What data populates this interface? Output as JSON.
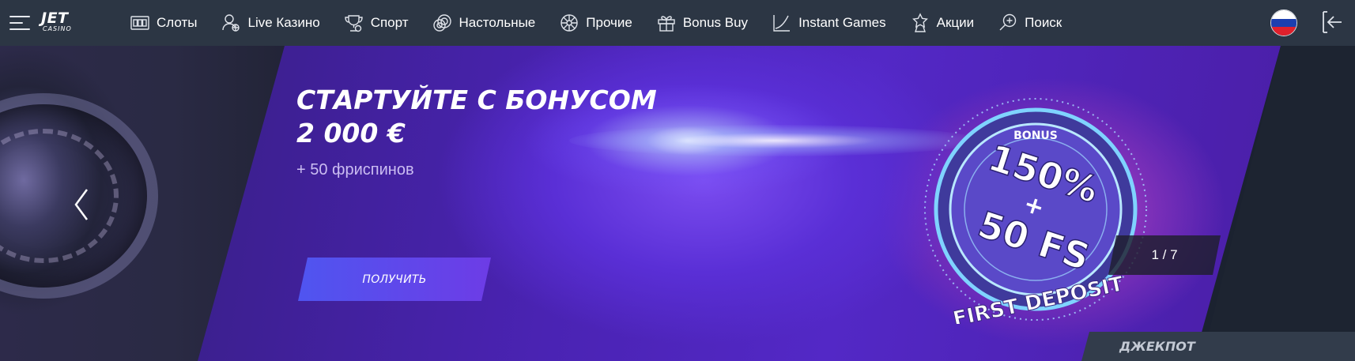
{
  "logo": {
    "main": "JET",
    "sub": "CASINO"
  },
  "nav": [
    {
      "label": "Слоты",
      "icon": "slot-machine-icon"
    },
    {
      "label": "Live Казино",
      "icon": "live-dealer-icon"
    },
    {
      "label": "Спорт",
      "icon": "sport-trophy-icon"
    },
    {
      "label": "Настольные",
      "icon": "chips-icon"
    },
    {
      "label": "Прочие",
      "icon": "wheel-icon"
    },
    {
      "label": "Bonus Buy",
      "icon": "gift-icon"
    },
    {
      "label": "Instant Games",
      "icon": "chart-line-icon"
    },
    {
      "label": "Акции",
      "icon": "promo-star-icon"
    },
    {
      "label": "Поиск",
      "icon": "search-icon"
    }
  ],
  "language": {
    "icon": "russia-flag-icon",
    "colors": [
      "#ffffff",
      "#1c3fb0",
      "#e0202c"
    ]
  },
  "login": {
    "icon": "login-icon"
  },
  "banner": {
    "headline": "СТАРТУЙТЕ С БОНУСОМ 2 000 €",
    "subline": "+ 50 фриспинов",
    "cta_label": "ПОЛУЧИТЬ",
    "counter": "1 / 7",
    "coin": {
      "top": "BONUS",
      "line1": "150%",
      "plus": "+",
      "line2": "50 FS",
      "bottom": "FIRST DEPOSIT"
    }
  },
  "jackpot_label": "ДЖЕКПОТ",
  "colors": {
    "topbar": "#2c3644",
    "cta_start": "#4f55f0",
    "cta_end": "#6d3ce6",
    "accent_purple": "#5328c6"
  }
}
